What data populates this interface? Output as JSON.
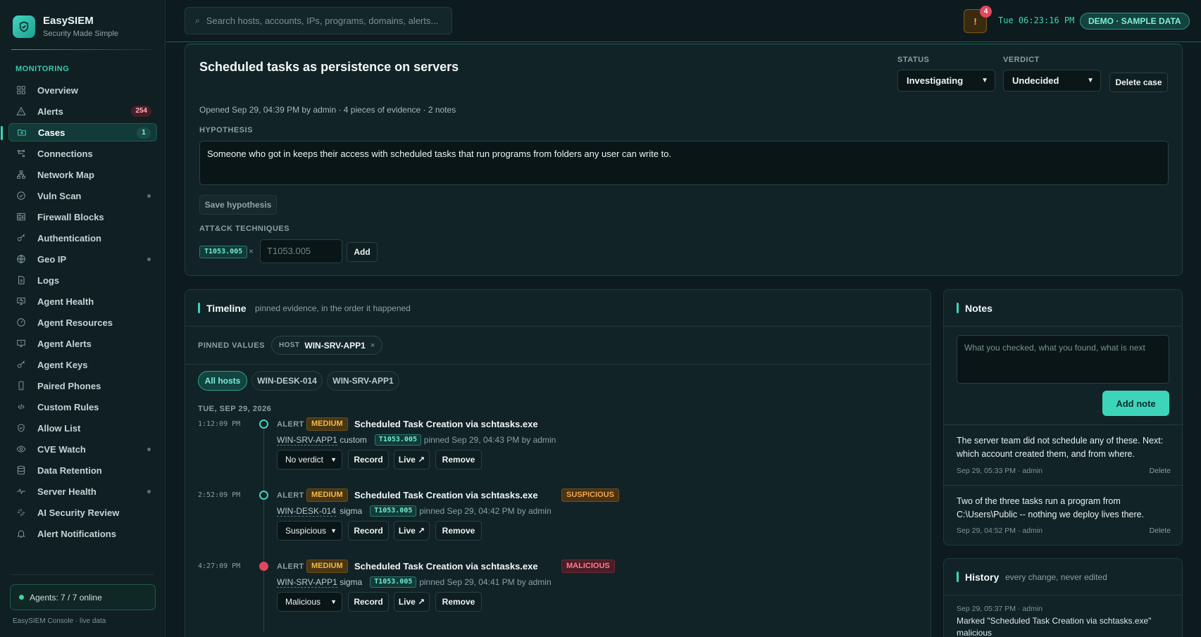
{
  "brand": {
    "name": "EasySIEM",
    "tagline": "Security Made Simple"
  },
  "sidebar": {
    "section": "MONITORING",
    "items": [
      {
        "label": "Overview",
        "icon": "grid-icon"
      },
      {
        "label": "Alerts",
        "icon": "warning-icon",
        "badge": "254"
      },
      {
        "label": "Cases",
        "icon": "folder-icon",
        "badge": "1",
        "active": true
      },
      {
        "label": "Connections",
        "icon": "connections-icon"
      },
      {
        "label": "Network Map",
        "icon": "network-icon"
      },
      {
        "label": "Vuln Scan",
        "icon": "scan-icon",
        "dot": true
      },
      {
        "label": "Firewall Blocks",
        "icon": "firewall-icon"
      },
      {
        "label": "Authentication",
        "icon": "key-icon"
      },
      {
        "label": "Geo IP",
        "icon": "globe-icon",
        "dot": true
      },
      {
        "label": "Logs",
        "icon": "document-icon"
      },
      {
        "label": "Agent Health",
        "icon": "monitor-icon"
      },
      {
        "label": "Agent Resources",
        "icon": "gauge-icon"
      },
      {
        "label": "Agent Alerts",
        "icon": "monitor-alert-icon"
      },
      {
        "label": "Agent Keys",
        "icon": "key-icon"
      },
      {
        "label": "Paired Phones",
        "icon": "phone-icon"
      },
      {
        "label": "Custom Rules",
        "icon": "code-icon"
      },
      {
        "label": "Allow List",
        "icon": "shield-check-icon"
      },
      {
        "label": "CVE Watch",
        "icon": "eye-icon",
        "dot": true
      },
      {
        "label": "Data Retention",
        "icon": "database-icon"
      },
      {
        "label": "Server Health",
        "icon": "pulse-icon",
        "dot": true
      },
      {
        "label": "AI Security Review",
        "icon": "sparkle-icon"
      },
      {
        "label": "Alert Notifications",
        "icon": "bell-icon"
      }
    ],
    "agents_status": "Agents: 7 / 7 online",
    "footer": "EasySIEM Console · live data"
  },
  "topbar": {
    "search_placeholder": "Search hosts, accounts, IPs, programs, domains, alerts...",
    "alert_count": "4",
    "clock": "Tue 06:23:16 PM",
    "demo_label": "DEMO · SAMPLE DATA"
  },
  "case": {
    "title": "Scheduled tasks as persistence on servers",
    "status_label": "STATUS",
    "status_value": "Investigating",
    "verdict_label": "VERDICT",
    "verdict_value": "Undecided",
    "delete_label": "Delete case",
    "meta": "Opened Sep 29, 04:39 PM by admin · 4 pieces of evidence · 2 notes",
    "hypothesis_label": "HYPOTHESIS",
    "hypothesis_text": "Someone who got in keeps their access with scheduled tasks that run programs from folders any user can write to.",
    "save_hypothesis_label": "Save hypothesis",
    "techniques_label": "ATT&CK TECHNIQUES",
    "technique_chip": "T1053.005",
    "technique_remove": "×",
    "technique_input_placeholder": "T1053.005",
    "add_label": "Add"
  },
  "timeline": {
    "title": "Timeline",
    "subtitle": "pinned evidence, in the order it happened",
    "pinned_label": "PINNED VALUES",
    "pinned_chip_key": "HOST",
    "pinned_chip_value": "WIN-SRV-APP1",
    "pinned_chip_remove": "×",
    "filters": [
      "All hosts",
      "WIN-DESK-014",
      "WIN-SRV-APP1"
    ],
    "day_label": "TUE, SEP 29, 2026",
    "record_label": "Record",
    "live_label": "Live ↗",
    "remove_label": "Remove",
    "events": [
      {
        "time": "1:12:09 PM",
        "kind": "ALERT",
        "severity": "MEDIUM",
        "title": "Scheduled Task Creation via schtasks.exe",
        "verdict": "",
        "host": "WIN-SRV-APP1",
        "source": "custom",
        "technique": "T1053.005",
        "pinned": "pinned Sep 29, 04:43 PM by admin",
        "select": "No verdict"
      },
      {
        "time": "2:52:09 PM",
        "kind": "ALERT",
        "severity": "MEDIUM",
        "title": "Scheduled Task Creation via schtasks.exe",
        "verdict": "SUSPICIOUS",
        "host": "WIN-DESK-014",
        "source": "sigma",
        "technique": "T1053.005",
        "pinned": "pinned Sep 29, 04:42 PM by admin",
        "select": "Suspicious"
      },
      {
        "time": "4:27:09 PM",
        "kind": "ALERT",
        "severity": "MEDIUM",
        "title": "Scheduled Task Creation via schtasks.exe",
        "verdict": "MALICIOUS",
        "host": "WIN-SRV-APP1",
        "source": "sigma",
        "technique": "T1053.005",
        "pinned": "pinned Sep 29, 04:41 PM by admin",
        "select": "Malicious"
      }
    ]
  },
  "notes": {
    "title": "Notes",
    "placeholder": "What you checked, what you found, what is next",
    "add_label": "Add note",
    "delete_label": "Delete",
    "items": [
      {
        "text": "The server team did not schedule any of these. Next: which account created them, and from where.",
        "meta": "Sep 29, 05:33 PM · admin"
      },
      {
        "text": "Two of the three tasks run a program from C:\\Users\\Public -- nothing we deploy lives there.",
        "meta": "Sep 29, 04:52 PM · admin"
      }
    ]
  },
  "history": {
    "title": "History",
    "subtitle": "every change, never edited",
    "entry_meta": "Sep 29, 05:37 PM · admin",
    "entry_text": "Marked \"Scheduled Task Creation via schtasks.exe\" malicious"
  },
  "colors": {
    "accent": "#3dd4bc",
    "background": "#0d1b1e",
    "medium": "#f3b94a",
    "malicious": "#ff7a90",
    "suspicious": "#f3a54a"
  }
}
